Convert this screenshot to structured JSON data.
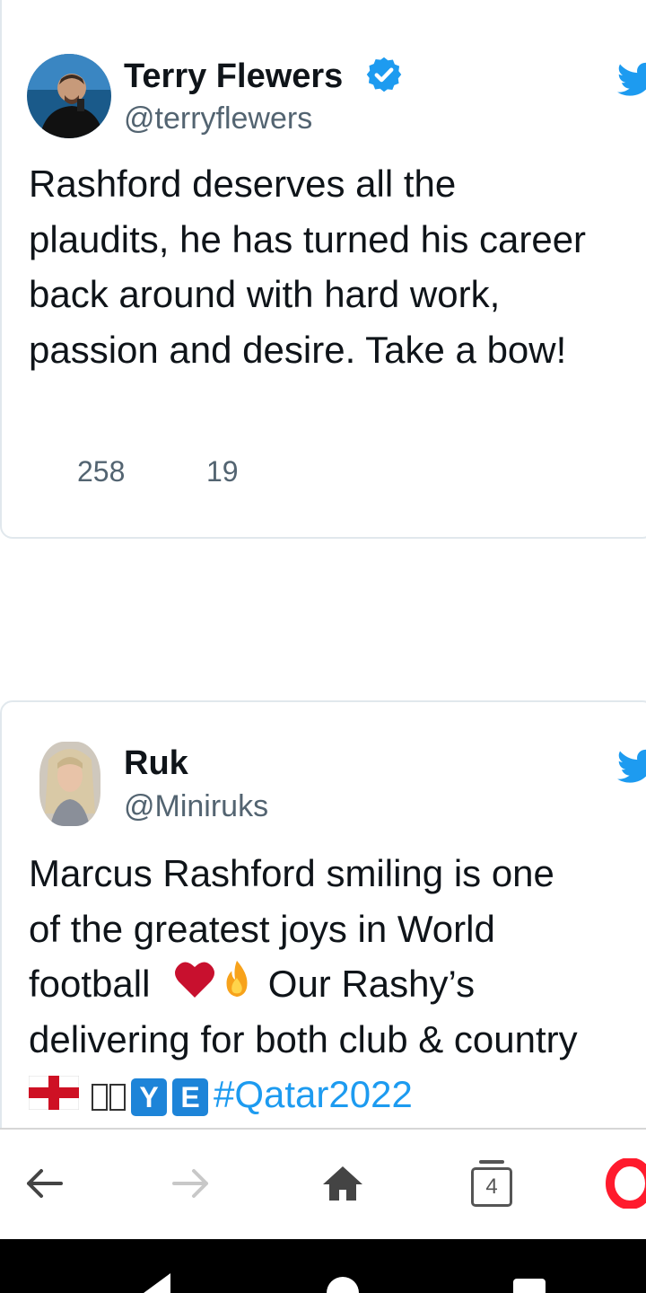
{
  "tweets": [
    {
      "author_name": "Terry Flewers",
      "author_handle": "@terryflewers",
      "verified": true,
      "text_lines": [
        "Rashford deserves all the",
        "plaudits, he has turned his career",
        "back around with hard work,",
        "passion and desire. Take a bow!"
      ],
      "likes": "258",
      "retweets": "19"
    },
    {
      "author_name": "Ruk",
      "author_handle": "@Miniruks",
      "verified": false,
      "text_lines": [
        "Marcus Rashford smiling is one",
        "of the greatest joys in World",
        "football",
        " Our Rashy’s",
        "delivering for both club & country"
      ],
      "badge_y": "Y",
      "badge_e": "E",
      "hashtag": "#Qatar2022"
    }
  ],
  "browser_toolbar": {
    "tabs_count": "4",
    "icons": [
      "back-arrow-icon",
      "forward-arrow-icon",
      "home-icon",
      "tabs-icon",
      "opera-logo-icon"
    ]
  },
  "colors": {
    "twitter_blue": "#1d9bf0",
    "verified_blue": "#1d9bf0",
    "handle_gray": "#536471",
    "heart_red": "#c8102e"
  }
}
